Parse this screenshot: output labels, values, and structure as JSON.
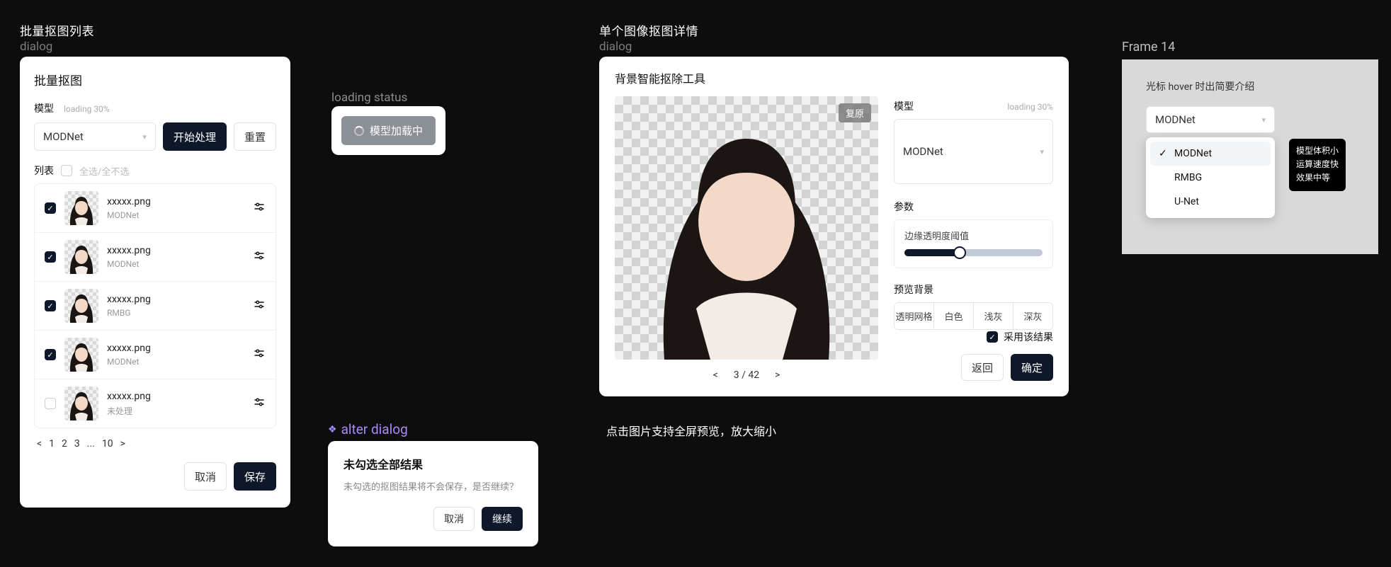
{
  "labels": {
    "batch_title": "批量抠图列表",
    "dialog": "dialog",
    "loading_status": "loading status",
    "alter_dialog": "alter dialog",
    "single_title": "单个图像抠图详情",
    "frame14": "Frame 14",
    "hint_fullscreen": "点击图片支持全屏预览，放大缩小"
  },
  "batch": {
    "heading": "批量抠图",
    "model_label": "模型",
    "loading": "loading 30%",
    "model_value": "MODNet",
    "start_btn": "开始处理",
    "reset_btn": "重置",
    "list_label": "列表",
    "select_all": "全选/全不选",
    "items": [
      {
        "checked": true,
        "filename": "xxxxx.png",
        "meta": "MODNet"
      },
      {
        "checked": true,
        "filename": "xxxxx.png",
        "meta": "MODNet"
      },
      {
        "checked": true,
        "filename": "xxxxx.png",
        "meta": "RMBG"
      },
      {
        "checked": true,
        "filename": "xxxxx.png",
        "meta": "MODNet"
      },
      {
        "checked": false,
        "filename": "xxxxx.png",
        "meta": "未处理"
      }
    ],
    "pager": {
      "prev": "<",
      "p1": "1",
      "p2": "2",
      "p3": "3",
      "dots": "...",
      "last": "10",
      "next": ">"
    },
    "cancel": "取消",
    "save": "保存"
  },
  "loading_pill": "模型加载中",
  "alter": {
    "title": "未勾选全部结果",
    "body": "未勾选的抠图结果将不会保存，是否继续？",
    "cancel": "取消",
    "continue": "继续"
  },
  "single": {
    "heading": "背景智能抠除工具",
    "restore": "复原",
    "counter": "3 / 42",
    "prev": "<",
    "next": ">",
    "model_label": "模型",
    "loading": "loading 30%",
    "model_value": "MODNet",
    "params_label": "参数",
    "param_name": "边缘透明度阈值",
    "bg_label": "预览背景",
    "bg_options": [
      "透明网格",
      "白色",
      "浅灰",
      "深灰"
    ],
    "adopt": "采用该结果",
    "back": "返回",
    "ok": "确定"
  },
  "frame14": {
    "tip": "光标 hover 时出简要介绍",
    "model_value": "MODNet",
    "options": [
      "MODNet",
      "RMBG",
      "U-Net"
    ],
    "tooltip": [
      "模型体积小",
      "运算速度快",
      "效果中等"
    ]
  }
}
